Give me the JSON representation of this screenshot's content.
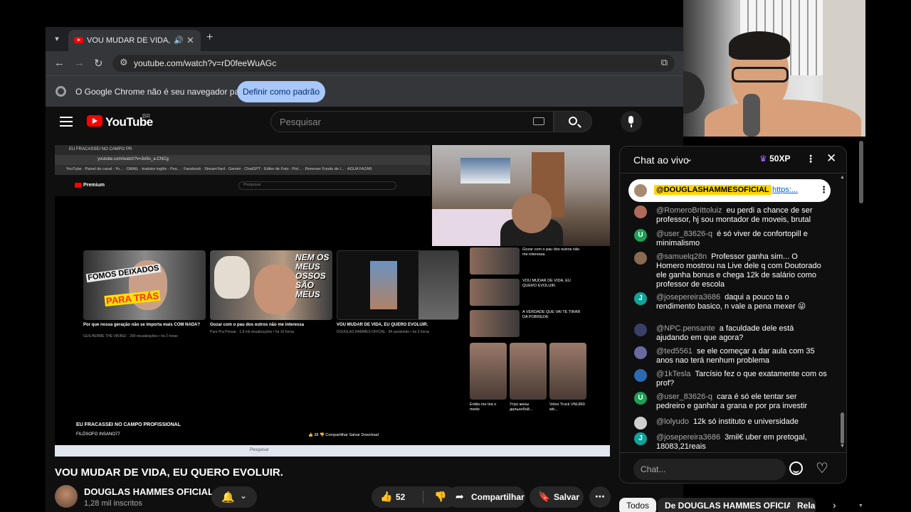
{
  "browser": {
    "tab_title": "VOU MUDAR DE VIDA, EU Q",
    "url": "youtube.com/watch?v=rD0feeWuAGc",
    "infobar_text": "O Google Chrome não é seu navegador padrão",
    "infobar_button": "Definir como padrão",
    "icons": {
      "tab_list": "▾",
      "audio": "🔊",
      "close": "✕",
      "new_tab": "+",
      "back": "←",
      "forward": "→",
      "reload": "↻",
      "tune": "⚙",
      "install": "⧉"
    }
  },
  "youtube": {
    "logo_text": "YouTube",
    "country": "BR",
    "search_placeholder": "Pesquisar"
  },
  "inner_screen": {
    "tab": "EU FRACASSEI NO CAMPO PR",
    "url": "youtube.com/watch?v=3o5o_a-CNCg",
    "bookmarks": "YouTube · Painel do canal - Yo... · GMAIL · tradutor inglês - Pes... · Facebook · StreamYard · Gemini · ChatGPT · Editor de Foto - Pixl... · Remover Fundo de I... · AGUA FAZAR",
    "logo": "Premium",
    "search": "Pesquisar",
    "thumb_a_line1": "FOMOS DEIXADOS",
    "thumb_a_line2": "PARA TRÁS",
    "thumb_b_text": "NEM OS MEUS OSSOS SÃO MEUS",
    "videos": [
      {
        "title": "Por que nossa geração não se importa mais COM NADA?",
        "meta": "GUILHERME THE VIKING! · 290 visualizações • há 2 horas"
      },
      {
        "title": "Gozar com o pau dos outros não me interessa",
        "meta": "Pare Pra Pensar · 1,8 mil visualizações • há 10 horas"
      },
      {
        "title": "VOU MUDAR DE VIDA, EU QUERO EVOLUIR.",
        "meta": "DOUGLAS HAMMES OFICIAL · 84 assistindo • há 3 horas"
      }
    ],
    "recs": [
      "Gozar com o pau dos outros não me interessa",
      "VOU MUDAR DE VIDA, EU QUERO EVOLUIR.",
      "A VERDADE QUE VAI TE TIRAR DA POBREZA!"
    ],
    "shorts": [
      "Então me tira o medo",
      "Утро жены дальнобой...",
      "Volvo Truck VNL860 wit..."
    ],
    "video_title": "EU FRACASSEI NO CAMPO PROFISSIONAL",
    "channel": "FILÓSOFO INSANO77",
    "actions": "👍 38   👎   Compartilhar   Salvar   Download",
    "taskbar": "Pesquisar"
  },
  "video": {
    "title": "VOU MUDAR DE VIDA, EU QUERO EVOLUIR.",
    "channel": "DOUGLAS HAMMES OFICIAL",
    "subscribers": "1,28 mil inscritos",
    "likes": "52",
    "share": "Compartilhar",
    "save": "Salvar",
    "icons": {
      "bell": "🔔",
      "chevron": "⌄",
      "like": "👍",
      "dislike": "👎",
      "share": "➦",
      "save": "🔖",
      "more": "⋯"
    }
  },
  "chat": {
    "title": "Chat ao vivo",
    "title_chevron": "⌄",
    "xp": "50XP",
    "kebab": "⋮",
    "close": "✕",
    "pinned": {
      "name": "@DOUGLASHAMMESOFICIAL",
      "link": "https:..."
    },
    "messages": [
      {
        "user": "@RomeroBrittoluiz",
        "text": "eu perdi a chance de ser professor, hj sou montador de moveis, brutal",
        "avatar": "",
        "color": "#b06a5a"
      },
      {
        "user": "@user_83626-q",
        "text": "é só viver de confortopill e minimalismo",
        "avatar": "U",
        "color": "#1e9e57"
      },
      {
        "user": "@samuelq28n",
        "text": "Professor ganha sim... O Homero mostrou na Live dele q com Doutorado ele ganha bonus e chega 12k de salário como professor de escola",
        "avatar": "",
        "color": "#8a6a50"
      },
      {
        "user": "@josepereira3686",
        "text": "daqui a pouco ta o rendimento basico, n vale a pena mexer 😜",
        "avatar": "J",
        "color": "#12a39a"
      },
      {
        "user": "@NPC.pensante",
        "text": "a faculdade dele está ajudando em que agora?",
        "avatar": "",
        "color": "#3a3f6a"
      },
      {
        "user": "@ted5561",
        "text": "se ele começar a dar aula com 35 anos nao terá nenhum problema",
        "avatar": "",
        "color": "#6a6aa0"
      },
      {
        "user": "@1kTesla",
        "text": "Tarcísio fez o que exatamente com os prof?",
        "avatar": "",
        "color": "#2a6ab0"
      },
      {
        "user": "@user_83626-q",
        "text": "cara é só ele tentar ser pedreiro e ganhar a grana e por pra investir",
        "avatar": "U",
        "color": "#1e9e57"
      },
      {
        "user": "@lolyudo",
        "text": "12k só instituto e universidade",
        "avatar": "",
        "color": "#d0d0d0"
      },
      {
        "user": "@josepereira3686",
        "text": "3mil€ uber em pretogal, 18083,21reais",
        "avatar": "J",
        "color": "#12a39a"
      }
    ],
    "input_placeholder": "Chat...",
    "heart": "♡"
  },
  "chips": [
    "Todos",
    "De DOUGLAS HAMMES OFICIAL",
    "Relac"
  ],
  "chip_next": "›"
}
